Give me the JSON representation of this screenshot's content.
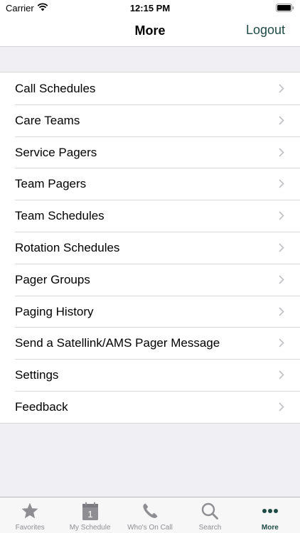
{
  "status_bar": {
    "carrier": "Carrier",
    "time": "12:15 PM"
  },
  "nav": {
    "title": "More",
    "logout_label": "Logout"
  },
  "menu": {
    "items": [
      {
        "label": "Call Schedules"
      },
      {
        "label": "Care Teams"
      },
      {
        "label": "Service Pagers"
      },
      {
        "label": "Team Pagers"
      },
      {
        "label": "Team Schedules"
      },
      {
        "label": "Rotation Schedules"
      },
      {
        "label": "Pager Groups"
      },
      {
        "label": "Paging History"
      },
      {
        "label": "Send a Satellink/AMS Pager Message"
      },
      {
        "label": "Settings"
      },
      {
        "label": "Feedback"
      }
    ]
  },
  "tab_bar": {
    "tabs": [
      {
        "label": "Favorites",
        "icon": "star-icon"
      },
      {
        "label": "My Schedule",
        "icon": "calendar-icon",
        "badge": "1"
      },
      {
        "label": "Who's On Call",
        "icon": "phone-icon"
      },
      {
        "label": "Search",
        "icon": "search-icon"
      },
      {
        "label": "More",
        "icon": "more-icon",
        "active": true
      }
    ]
  },
  "colors": {
    "accent": "#1f4a45",
    "inactive": "#8e8e93",
    "background": "#efeff4"
  }
}
